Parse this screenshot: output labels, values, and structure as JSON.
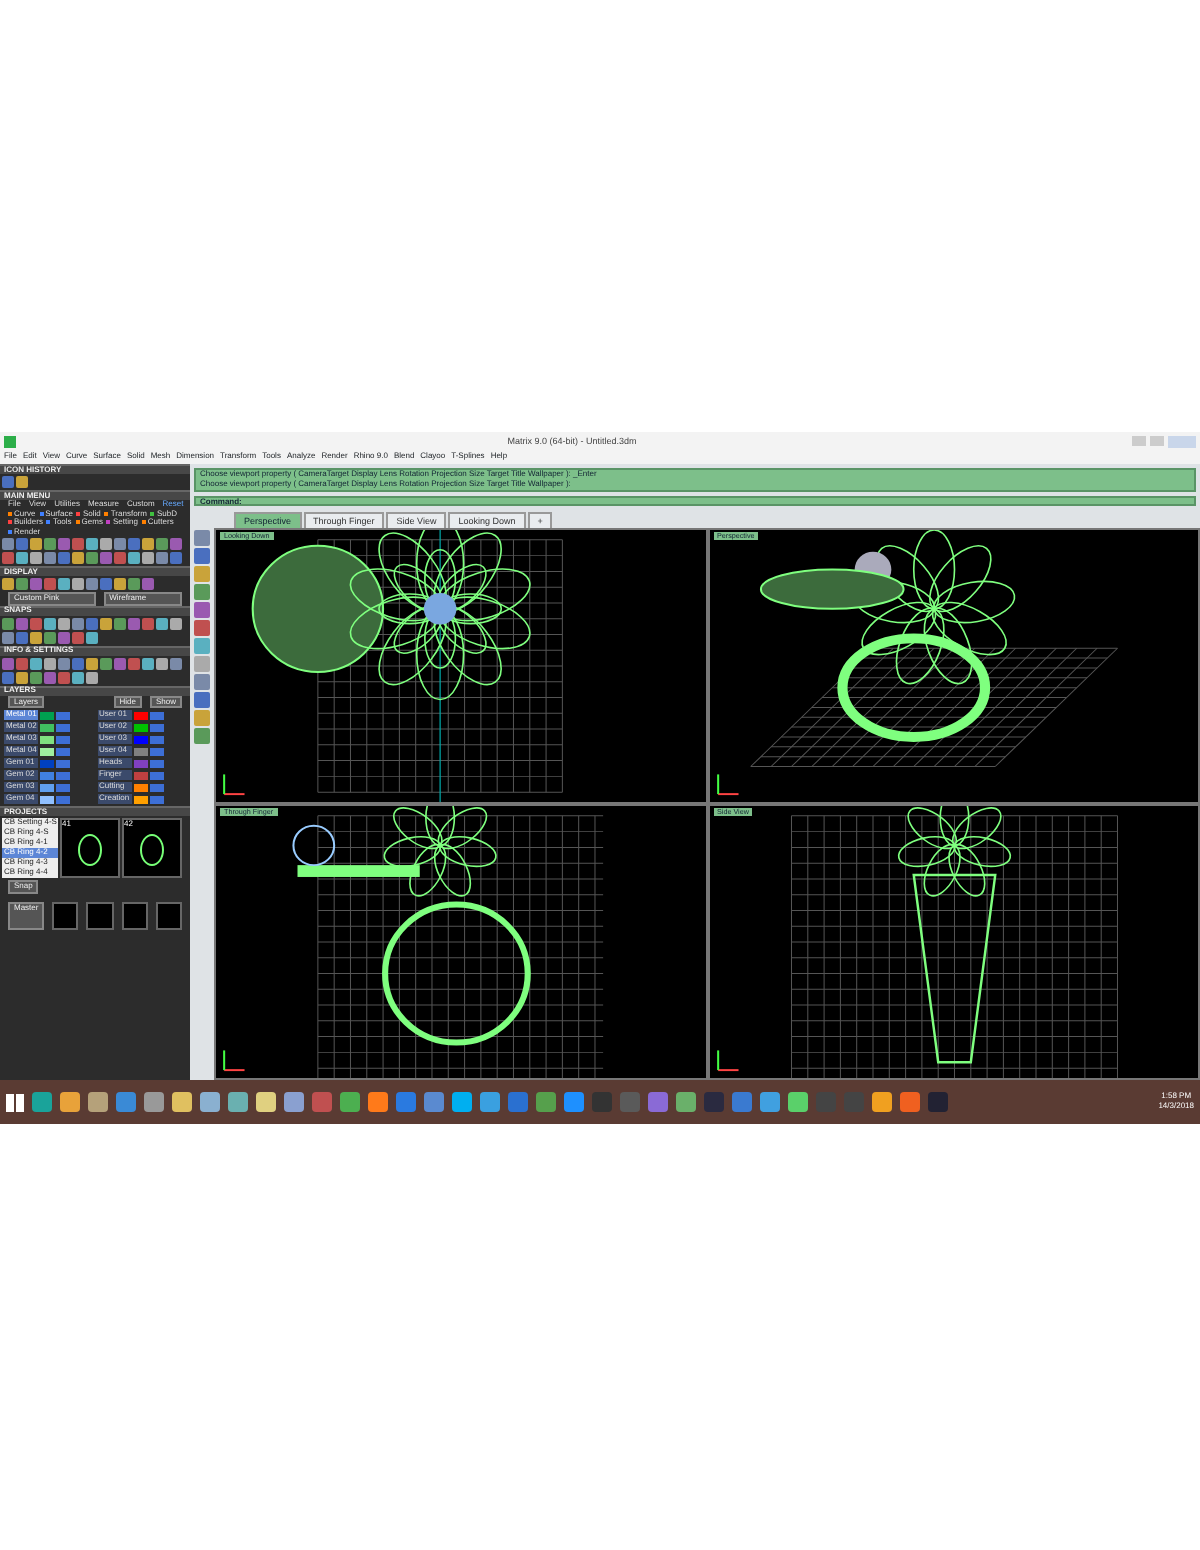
{
  "window": {
    "title": "Matrix 9.0 (64-bit) - Untitled.3dm"
  },
  "menu": [
    "File",
    "Edit",
    "View",
    "Curve",
    "Surface",
    "Solid",
    "Mesh",
    "Dimension",
    "Transform",
    "Tools",
    "Analyze",
    "Render",
    "Rhino 9.0",
    "Blend",
    "Clayoo",
    "T-Splines",
    "Help"
  ],
  "command_lines": [
    "Choose viewport property ( CameraTarget  Display  Lens  Rotation  Projection  Size  Target  Title  Wallpaper ): _Enter",
    "Choose viewport property ( CameraTarget  Display  Lens  Rotation  Projection  Size  Target  Title  Wallpaper ):"
  ],
  "command_prompt": "Command:",
  "viewport_tabs": [
    {
      "label": "Perspective",
      "selected": true
    },
    {
      "label": "Through Finger",
      "selected": false
    },
    {
      "label": "Side View",
      "selected": false
    },
    {
      "label": "Looking Down",
      "selected": false
    },
    {
      "label": "+",
      "selected": false
    }
  ],
  "viewports": [
    {
      "label": "Looking Down",
      "kind": "top"
    },
    {
      "label": "Perspective",
      "kind": "perspective"
    },
    {
      "label": "Through Finger",
      "kind": "front"
    },
    {
      "label": "Side View",
      "kind": "side"
    }
  ],
  "left_panel": {
    "icon_history_title": "ICON HISTORY",
    "main_menu_title": "MAIN MENU",
    "main_menu_items": [
      "File",
      "View",
      "Utilities",
      "Measure",
      "Custom"
    ],
    "main_menu_reset": "Reset",
    "main_menu_tabs": [
      {
        "label": "Curve",
        "color": "#ff8000"
      },
      {
        "label": "Surface",
        "color": "#4080ff"
      },
      {
        "label": "Solid",
        "color": "#ff4040"
      },
      {
        "label": "Transform",
        "color": "#ff8000"
      },
      {
        "label": "SubD",
        "color": "#40c040"
      },
      {
        "label": "Builders",
        "color": "#ff4040"
      },
      {
        "label": "Tools",
        "color": "#4080ff"
      },
      {
        "label": "Gems",
        "color": "#ff8000"
      },
      {
        "label": "Setting",
        "color": "#c040c0"
      },
      {
        "label": "Cutters",
        "color": "#ff8000"
      },
      {
        "label": "Render",
        "color": "#4080ff"
      }
    ],
    "display_title": "DISPLAY",
    "display_mode": "Custom Pink",
    "display_shade": "Wireframe",
    "snaps_title": "SNAPS",
    "info_title": "INFO & SETTINGS",
    "layers_title": "LAYERS",
    "layers_label": "Layers",
    "layers_hide": "Hide",
    "layers_show": "Show",
    "layers": [
      {
        "name": "Metal 01",
        "color": "#00a050",
        "selected": true,
        "visible": true
      },
      {
        "name": "User 01",
        "color": "#ff0000",
        "selected": false,
        "visible": true
      },
      {
        "name": "Metal 02",
        "color": "#40c060",
        "selected": false,
        "visible": true
      },
      {
        "name": "User 02",
        "color": "#00c000",
        "selected": false,
        "visible": true
      },
      {
        "name": "Metal 03",
        "color": "#80e080",
        "selected": false,
        "visible": true
      },
      {
        "name": "User 03",
        "color": "#0000ff",
        "selected": false,
        "visible": true
      },
      {
        "name": "Metal 04",
        "color": "#a0f0a0",
        "selected": false,
        "visible": true
      },
      {
        "name": "User 04",
        "color": "#808080",
        "selected": false,
        "visible": true
      },
      {
        "name": "Gem 01",
        "color": "#0040c0",
        "selected": false,
        "visible": true
      },
      {
        "name": "Heads",
        "color": "#8040c0",
        "selected": false,
        "visible": true
      },
      {
        "name": "Gem 02",
        "color": "#4080e0",
        "selected": false,
        "visible": true
      },
      {
        "name": "Finger",
        "color": "#c04040",
        "selected": false,
        "visible": true
      },
      {
        "name": "Gem 03",
        "color": "#60a0f0",
        "selected": false,
        "visible": true
      },
      {
        "name": "Cutting",
        "color": "#ff8000",
        "selected": false,
        "visible": true
      },
      {
        "name": "Gem 04",
        "color": "#90c0ff",
        "selected": false,
        "visible": true
      },
      {
        "name": "Creation",
        "color": "#ffa000",
        "selected": false,
        "visible": true
      }
    ],
    "projects_title": "PROJECTS",
    "projects": [
      {
        "name": "CB Setting 4-S",
        "selected": false
      },
      {
        "name": "CB Ring 4-S",
        "selected": false
      },
      {
        "name": "CB Ring 4-1",
        "selected": false
      },
      {
        "name": "CB Ring 4-2",
        "selected": true
      },
      {
        "name": "CB Ring 4-3",
        "selected": false
      },
      {
        "name": "CB Ring 4-4",
        "selected": false
      }
    ],
    "project_thumbs": [
      "41",
      "42"
    ],
    "project_button": "Snap",
    "library_label": "Master"
  },
  "taskbar": {
    "time": "1:58 PM",
    "date": "14/3/2018"
  }
}
